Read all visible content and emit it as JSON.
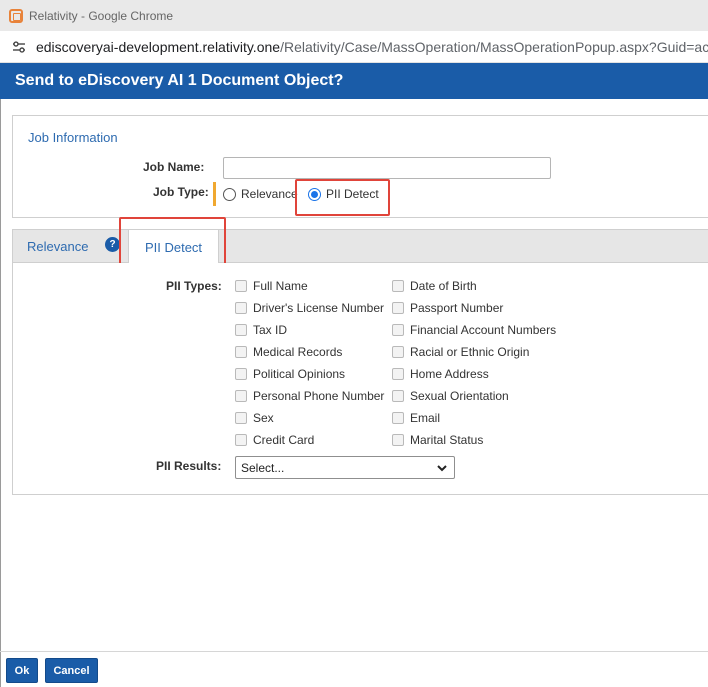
{
  "window": {
    "title": "Relativity - Google Chrome",
    "url_host": "ediscoveryai-development.relativity.one",
    "url_path": "/Relativity/Case/MassOperation/MassOperationPopup.aspx?Guid=ac"
  },
  "dialog": {
    "title": "Send to eDiscovery AI 1 Document Object?"
  },
  "job_info": {
    "section_title": "Job Information",
    "job_name_label": "Job Name:",
    "job_name_value": "",
    "job_type_label": "Job Type:",
    "job_type_options": [
      "Relevance",
      "PII Detect"
    ],
    "job_type_selected": "PII Detect"
  },
  "tabs": {
    "items": [
      "Relevance",
      "PII Detect"
    ],
    "active": "PII Detect",
    "help_glyph": "?"
  },
  "pii": {
    "types_label": "PII Types:",
    "types_col1": [
      "Full Name",
      "Driver's License Number",
      "Tax ID",
      "Medical Records",
      "Political Opinions",
      "Personal Phone Number",
      "Sex",
      "Credit Card"
    ],
    "types_col2": [
      "Date of Birth",
      "Passport Number",
      "Financial Account Numbers",
      "Racial or Ethnic Origin",
      "Home Address",
      "Sexual Orientation",
      "Email",
      "Marital Status"
    ],
    "results_label": "PII Results:",
    "results_value": "Select..."
  },
  "footer": {
    "ok_label": "Ok",
    "cancel_label": "Cancel"
  },
  "colors": {
    "header_blue": "#1a5ca8",
    "highlight_red": "#e0443a",
    "required_orange": "#f0a830"
  }
}
